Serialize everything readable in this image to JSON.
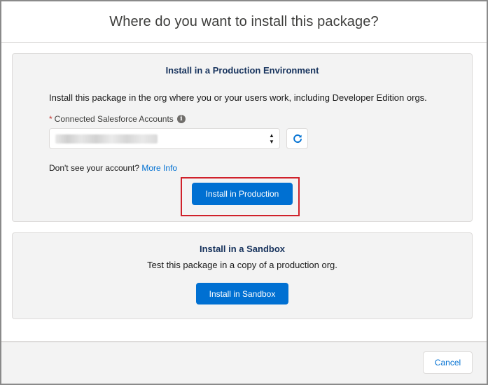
{
  "modal": {
    "title": "Where do you want to install this package?"
  },
  "production": {
    "title": "Install in a Production Environment",
    "description": "Install this package in the org where you or your users work, including Developer Edition orgs.",
    "field": {
      "required_marker": "*",
      "label": "Connected Salesforce Accounts",
      "info_icon": "info-icon",
      "value": ""
    },
    "refresh_icon": "refresh-icon",
    "account_note": "Don't see your account?",
    "more_info_link": "More Info",
    "button_label": "Install in Production",
    "highlight_color": "#d0212a"
  },
  "sandbox": {
    "title": "Install in a Sandbox",
    "description": "Test this package in a copy of a production org.",
    "button_label": "Install in Sandbox"
  },
  "footer": {
    "cancel_label": "Cancel"
  },
  "colors": {
    "brand": "#0070d2",
    "card_bg": "#f3f3f3",
    "title_text": "#16325c"
  }
}
